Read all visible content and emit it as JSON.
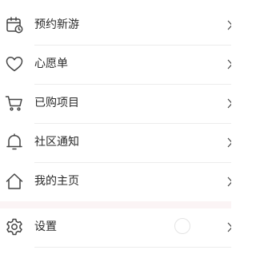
{
  "menu": {
    "items": [
      {
        "id": "new-tour",
        "label": "预约新游",
        "icon": "calendar-clock-icon"
      },
      {
        "id": "wishlist",
        "label": "心愿单",
        "icon": "heart-icon"
      },
      {
        "id": "purchased",
        "label": "已购项目",
        "icon": "cart-icon"
      },
      {
        "id": "notifications",
        "label": "社区通知",
        "icon": "bell-icon"
      },
      {
        "id": "homepage",
        "label": "我的主页",
        "icon": "home-icon"
      },
      {
        "id": "settings",
        "label": "设置",
        "icon": "gear-icon"
      }
    ]
  },
  "colors": {
    "icon_stroke": "#444444",
    "section_gap_background": "#fbf4f5",
    "divider": "#ececec"
  }
}
